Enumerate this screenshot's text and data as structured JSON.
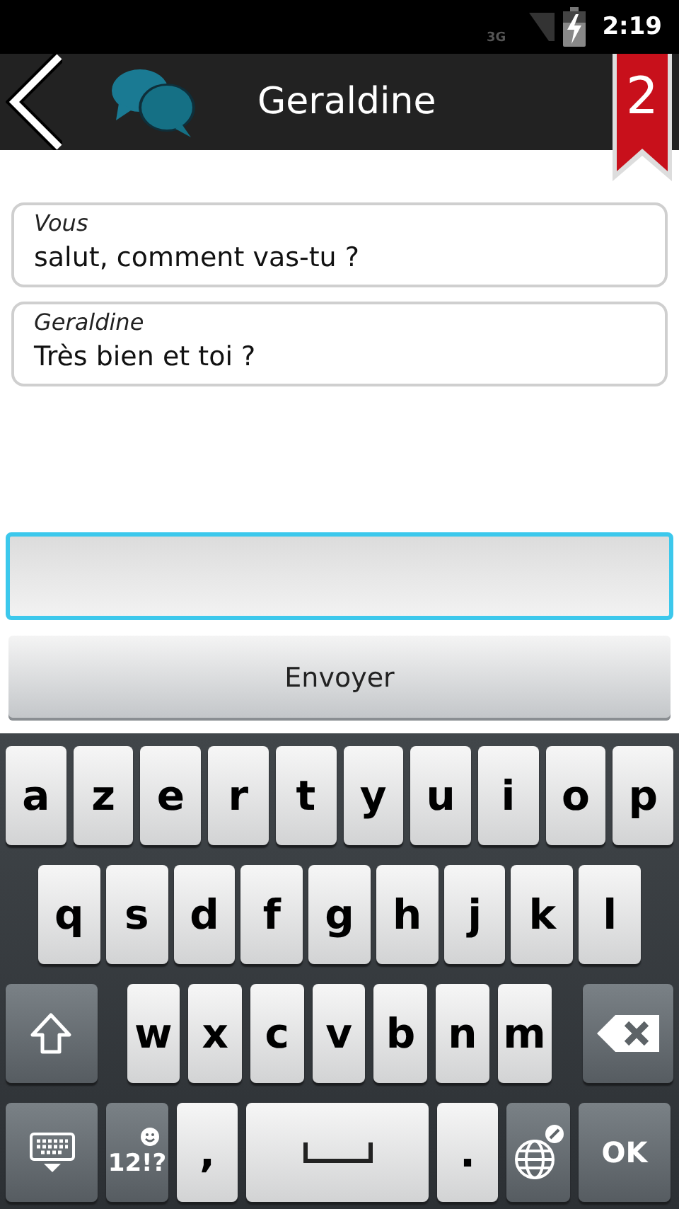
{
  "status_bar": {
    "network": "3G",
    "time": "2:19"
  },
  "header": {
    "title": "Geraldine",
    "badge": "2"
  },
  "messages": [
    {
      "sender": "Vous",
      "text": "salut, comment vas-tu ?"
    },
    {
      "sender": "Geraldine",
      "text": "Très bien et toi ?"
    }
  ],
  "compose": {
    "focused": true,
    "send_label": "Envoyer"
  },
  "keyboard": {
    "rows": [
      {
        "keys": [
          {
            "kind": "letter",
            "label": "a"
          },
          {
            "kind": "letter",
            "label": "z"
          },
          {
            "kind": "letter",
            "label": "e"
          },
          {
            "kind": "letter",
            "label": "r"
          },
          {
            "kind": "letter",
            "label": "t"
          },
          {
            "kind": "letter",
            "label": "y"
          },
          {
            "kind": "letter",
            "label": "u"
          },
          {
            "kind": "letter",
            "label": "i"
          },
          {
            "kind": "letter",
            "label": "o"
          },
          {
            "kind": "letter",
            "label": "p"
          }
        ]
      },
      {
        "keys": [
          {
            "kind": "letter",
            "label": "q"
          },
          {
            "kind": "letter",
            "label": "s"
          },
          {
            "kind": "letter",
            "label": "d"
          },
          {
            "kind": "letter",
            "label": "f"
          },
          {
            "kind": "letter",
            "label": "g"
          },
          {
            "kind": "letter",
            "label": "h"
          },
          {
            "kind": "letter",
            "label": "j"
          },
          {
            "kind": "letter",
            "label": "k"
          },
          {
            "kind": "letter",
            "label": "l"
          }
        ]
      },
      {
        "keys": [
          {
            "kind": "shift"
          },
          {
            "kind": "letter",
            "label": "w"
          },
          {
            "kind": "letter",
            "label": "x"
          },
          {
            "kind": "letter",
            "label": "c"
          },
          {
            "kind": "letter",
            "label": "v"
          },
          {
            "kind": "letter",
            "label": "b"
          },
          {
            "kind": "letter",
            "label": "n"
          },
          {
            "kind": "letter",
            "label": "m"
          },
          {
            "kind": "backspace"
          }
        ]
      },
      {
        "keys": [
          {
            "kind": "hide"
          },
          {
            "kind": "symbols",
            "label": "12!?"
          },
          {
            "kind": "letter",
            "label": ","
          },
          {
            "kind": "space"
          },
          {
            "kind": "letter",
            "label": "."
          },
          {
            "kind": "language"
          },
          {
            "kind": "action",
            "label": "OK"
          }
        ]
      }
    ]
  }
}
